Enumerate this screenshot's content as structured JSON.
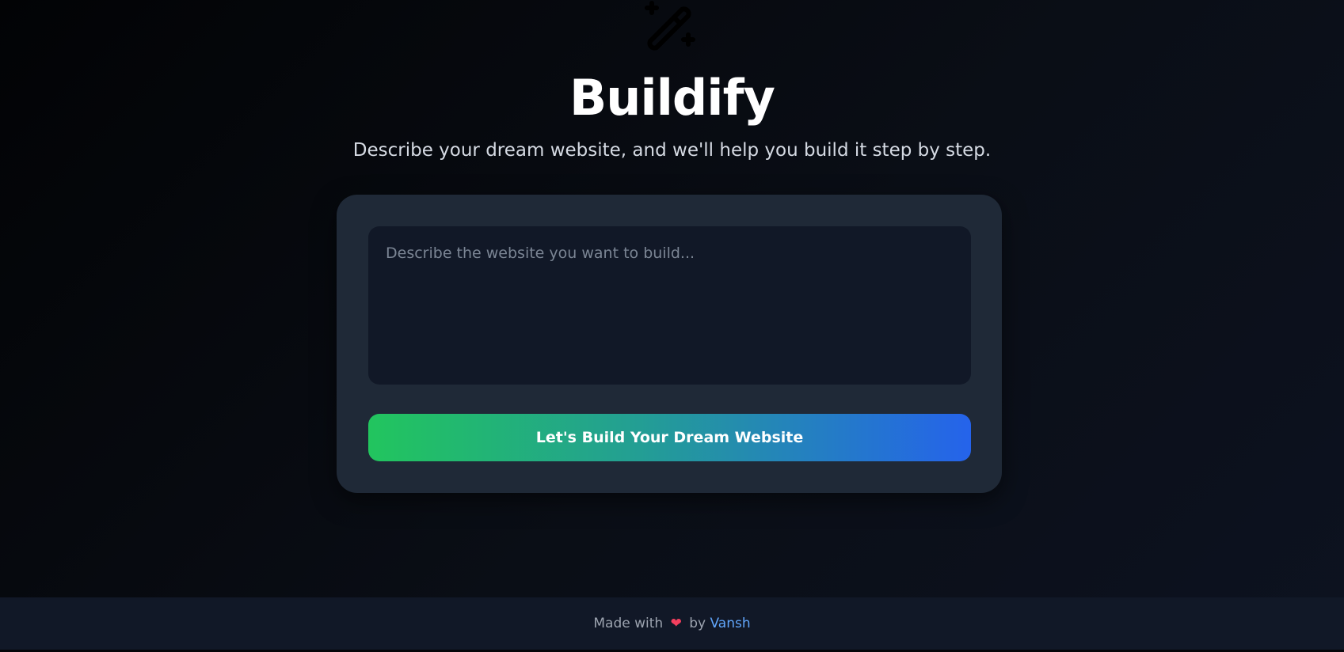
{
  "app": {
    "icon": "magic-wand-icon",
    "title": "Buildify",
    "subtitle": "Describe your dream website, and we'll help you build it step by step."
  },
  "form": {
    "prompt_value": "",
    "prompt_placeholder": "Describe the website you want to build...",
    "submit_label": "Let's Build Your Dream Website"
  },
  "footer": {
    "prefix": "Made with",
    "heart": "❤",
    "by": "by",
    "author": "Vansh"
  },
  "colors": {
    "card": "#1f2937",
    "input": "#111827",
    "gradient_start": "#22c55e",
    "gradient_end": "#2563eb",
    "link": "#60a5fa"
  }
}
